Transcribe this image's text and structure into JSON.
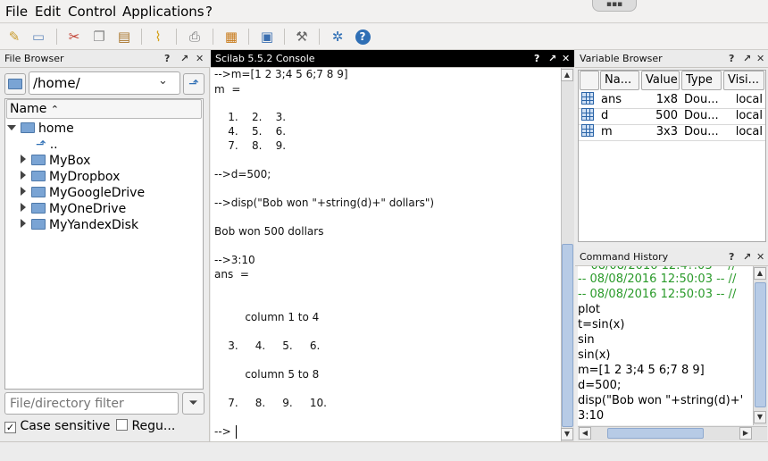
{
  "menu": {
    "file": "File",
    "edit": "Edit",
    "control": "Control",
    "applications": "Applications",
    "help": "?"
  },
  "toolbar": {
    "icons": [
      "new-script-icon",
      "open-file-icon",
      "cut-icon",
      "copy-icon",
      "paste-icon",
      "clear-console-icon",
      "print-icon",
      "variable-browser-icon",
      "demos-icon",
      "preferences-icon",
      "module-manager-icon",
      "help-icon"
    ]
  },
  "file_browser": {
    "title": "File Browser",
    "path": "/home/",
    "column_header": "Name",
    "items": [
      {
        "label": "home",
        "expanded": true
      },
      {
        "label": ".."
      },
      {
        "label": "MyBox"
      },
      {
        "label": "MyDropbox"
      },
      {
        "label": "MyGoogleDrive"
      },
      {
        "label": "MyOneDrive"
      },
      {
        "label": "MyYandexDisk"
      }
    ],
    "filter_placeholder": "File/directory filter",
    "case_sensitive_label": "Case sensitive",
    "case_sensitive_checked": true,
    "regex_label": "Regu...",
    "regex_checked": false
  },
  "console": {
    "title": "Scilab 5.5.2 Console",
    "lines": [
      "-->m=[1 2 3;4 5 6;7 8 9]",
      "m  =",
      "    1.    2.    3.",
      "    4.    5.    6.",
      "    7.    8.    9.",
      "-->d=500;",
      "-->disp(\"Bob won \"+string(d)+\" dollars\")",
      "Bob won 500 dollars",
      "-->3:10",
      "ans  =",
      "         column 1 to 4",
      "    3.     4.     5.     6.",
      "         column 5 to 8",
      "    7.     8.     9.     10.",
      "-->"
    ]
  },
  "variable_browser": {
    "title": "Variable Browser",
    "headers": [
      "Na...",
      "Value",
      "Type",
      "Visi..."
    ],
    "rows": [
      {
        "name": "ans",
        "value": "1x8",
        "type": "Dou...",
        "visibility": "local"
      },
      {
        "name": "d",
        "value": "500",
        "type": "Dou...",
        "visibility": "local"
      },
      {
        "name": "m",
        "value": "3x3",
        "type": "Dou...",
        "visibility": "local"
      }
    ]
  },
  "command_history": {
    "title": "Command History",
    "lines": [
      {
        "text": "-- 08/08/2016 12:50:03 -- //",
        "session": true
      },
      {
        "text": "-- 08/08/2016 12:50:03 -- //",
        "session": true
      },
      {
        "text": "plot",
        "session": false
      },
      {
        "text": "t=sin(x)",
        "session": false
      },
      {
        "text": "sin",
        "session": false
      },
      {
        "text": "sin(x)",
        "session": false
      },
      {
        "text": "m=[1 2 3;4 5 6;7 8 9]",
        "session": false
      },
      {
        "text": "d=500;",
        "session": false
      },
      {
        "text": "disp(\"Bob won \"+string(d)+'",
        "session": false
      },
      {
        "text": "3:10",
        "session": false
      }
    ]
  },
  "colors": {
    "session_text": "#2a9a2a",
    "console_header": "#000000",
    "scroll_thumb": "#b7cbe6"
  }
}
